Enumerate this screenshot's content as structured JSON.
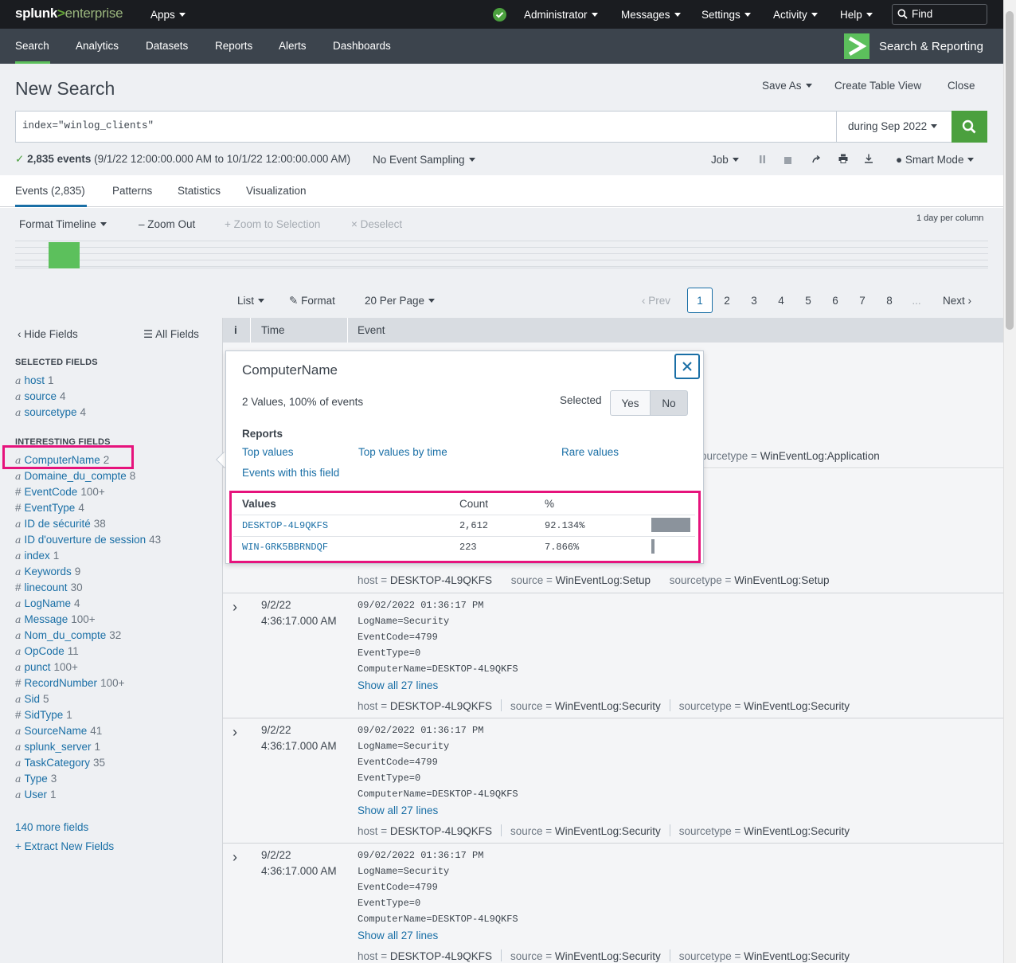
{
  "topbar": {
    "logo_splunk": "splunk",
    "logo_gt": ">",
    "logo_enterprise": "enterprise",
    "apps": "Apps",
    "administrator": "Administrator",
    "messages": "Messages",
    "settings": "Settings",
    "activity": "Activity",
    "help": "Help",
    "find_placeholder": "Find"
  },
  "appbar": {
    "tabs": [
      "Search",
      "Analytics",
      "Datasets",
      "Reports",
      "Alerts",
      "Dashboards"
    ],
    "app_name": "Search & Reporting"
  },
  "header": {
    "title": "New Search",
    "save_as": "Save As",
    "create_table_view": "Create Table View",
    "close": "Close"
  },
  "search": {
    "query": "index=\"winlog_clients\"",
    "time_range": "during Sep 2022"
  },
  "status": {
    "check": "✓",
    "count": "2,835 events",
    "range": "(9/1/22 12:00:00.000 AM to 10/1/22 12:00:00.000 AM)",
    "sampling": "No Event Sampling",
    "job": "Job",
    "mode": "Smart Mode"
  },
  "result_tabs": [
    "Events (2,835)",
    "Patterns",
    "Statistics",
    "Visualization"
  ],
  "timeline": {
    "format": "Format Timeline",
    "zoom_out": "Zoom Out",
    "zoom_selection": "Zoom to Selection",
    "deselect": "Deselect",
    "note": "1 day per column"
  },
  "controls": {
    "list": "List",
    "format": "Format",
    "per_page": "20 Per Page",
    "prev": "Prev",
    "pages": [
      "1",
      "2",
      "3",
      "4",
      "5",
      "6",
      "7",
      "8",
      "..."
    ],
    "next": "Next"
  },
  "sidebar": {
    "hide_fields": "Hide Fields",
    "all_fields": "All Fields",
    "selected_heading": "SELECTED FIELDS",
    "selected": [
      {
        "type": "a",
        "name": "host",
        "count": "1"
      },
      {
        "type": "a",
        "name": "source",
        "count": "4"
      },
      {
        "type": "a",
        "name": "sourcetype",
        "count": "4"
      }
    ],
    "interesting_heading": "INTERESTING FIELDS",
    "interesting": [
      {
        "type": "a",
        "name": "ComputerName",
        "count": "2"
      },
      {
        "type": "a",
        "name": "Domaine_du_compte",
        "count": "8"
      },
      {
        "type": "#",
        "name": "EventCode",
        "count": "100+"
      },
      {
        "type": "#",
        "name": "EventType",
        "count": "4"
      },
      {
        "type": "a",
        "name": "ID de sécurité",
        "count": "38"
      },
      {
        "type": "a",
        "name": "ID d'ouverture de session",
        "count": "43"
      },
      {
        "type": "a",
        "name": "index",
        "count": "1"
      },
      {
        "type": "a",
        "name": "Keywords",
        "count": "9"
      },
      {
        "type": "#",
        "name": "linecount",
        "count": "30"
      },
      {
        "type": "a",
        "name": "LogName",
        "count": "4"
      },
      {
        "type": "a",
        "name": "Message",
        "count": "100+"
      },
      {
        "type": "a",
        "name": "Nom_du_compte",
        "count": "32"
      },
      {
        "type": "a",
        "name": "OpCode",
        "count": "11"
      },
      {
        "type": "a",
        "name": "punct",
        "count": "100+"
      },
      {
        "type": "#",
        "name": "RecordNumber",
        "count": "100+"
      },
      {
        "type": "a",
        "name": "Sid",
        "count": "5"
      },
      {
        "type": "#",
        "name": "SidType",
        "count": "1"
      },
      {
        "type": "a",
        "name": "SourceName",
        "count": "41"
      },
      {
        "type": "a",
        "name": "splunk_server",
        "count": "1"
      },
      {
        "type": "a",
        "name": "TaskCategory",
        "count": "35"
      },
      {
        "type": "a",
        "name": "Type",
        "count": "3"
      },
      {
        "type": "a",
        "name": "User",
        "count": "1"
      }
    ],
    "more_fields": "140 more fields",
    "extract": "+ Extract New Fields"
  },
  "table": {
    "col_i": "i",
    "col_time": "Time",
    "col_event": "Event"
  },
  "events": {
    "partial0": {
      "k": "ourcetype =",
      "v": "WinEventLog:Application"
    },
    "partial1": {
      "host_k": "host =",
      "host_v": "DESKTOP-4L9QKFS",
      "source_k": "source =",
      "source_v": "WinEventLog:Setup",
      "st_k": "sourcetype =",
      "st_v": "WinEventLog:Setup"
    },
    "rows": [
      {
        "date": "9/2/22",
        "time": "4:36:17.000 AM",
        "lines": [
          "09/02/2022 01:36:17 PM",
          "LogName=Security",
          "EventCode=4799",
          "EventType=0",
          "ComputerName=DESKTOP-4L9QKFS"
        ],
        "show": "Show all 27 lines",
        "host": "DESKTOP-4L9QKFS",
        "source": "WinEventLog:Security",
        "sourcetype": "WinEventLog:Security"
      },
      {
        "date": "9/2/22",
        "time": "4:36:17.000 AM",
        "lines": [
          "09/02/2022 01:36:17 PM",
          "LogName=Security",
          "EventCode=4799",
          "EventType=0",
          "ComputerName=DESKTOP-4L9QKFS"
        ],
        "show": "Show all 27 lines",
        "host": "DESKTOP-4L9QKFS",
        "source": "WinEventLog:Security",
        "sourcetype": "WinEventLog:Security"
      },
      {
        "date": "9/2/22",
        "time": "4:36:17.000 AM",
        "lines": [
          "09/02/2022 01:36:17 PM",
          "LogName=Security",
          "EventCode=4799",
          "EventType=0",
          "ComputerName=DESKTOP-4L9QKFS"
        ],
        "show": "Show all 27 lines",
        "host": "DESKTOP-4L9QKFS",
        "source": "WinEventLog:Security",
        "sourcetype": "WinEventLog:Security"
      }
    ],
    "host_k": "host =",
    "source_k": "source =",
    "sourcetype_k": "sourcetype ="
  },
  "popup": {
    "title": "ComputerName",
    "summary": "2 Values, 100% of events",
    "selected": "Selected",
    "yes": "Yes",
    "no": "No",
    "reports": "Reports",
    "top_values": "Top values",
    "top_values_time": "Top values by time",
    "rare_values": "Rare values",
    "events_with_field": "Events with this field",
    "col_values": "Values",
    "col_count": "Count",
    "col_pct": "%",
    "values": [
      {
        "value": "DESKTOP-4L9QKFS",
        "count": "2,612",
        "pct": "92.134%",
        "fraction": 0.92134
      },
      {
        "value": "WIN-GRK5BBRNDQF",
        "count": "223",
        "pct": "7.866%",
        "fraction": 0.07866
      }
    ]
  },
  "colors": {
    "accent_green": "#5cc05c",
    "link_blue": "#1a6fa6",
    "highlight_pink": "#e6137c"
  }
}
